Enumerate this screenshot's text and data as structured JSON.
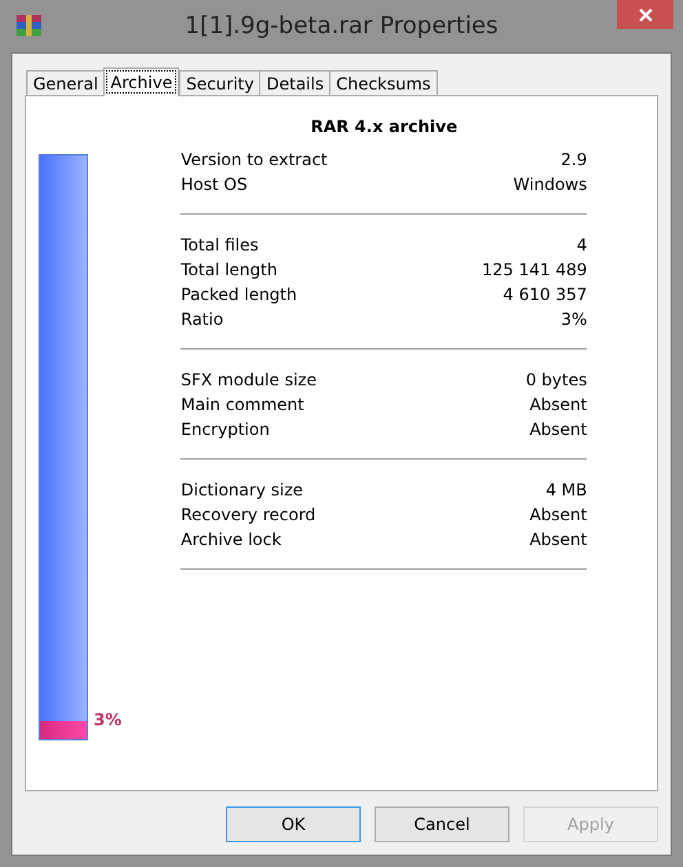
{
  "window": {
    "title": "1[1].9g-beta.rar Properties"
  },
  "tabs": [
    {
      "label": "General",
      "selected": false
    },
    {
      "label": "Archive",
      "selected": true
    },
    {
      "label": "Security",
      "selected": false
    },
    {
      "label": "Details",
      "selected": false
    },
    {
      "label": "Checksums",
      "selected": false
    }
  ],
  "ratio_bar": {
    "level": 0.03,
    "reading": "3%"
  },
  "heading": "RAR 4.x archive",
  "groups": [
    [
      {
        "label": "Version to extract",
        "value": "2.9"
      },
      {
        "label": "Host OS",
        "value": "Windows"
      }
    ],
    [
      {
        "label": "Total files",
        "value": "4"
      },
      {
        "label": "Total length",
        "value": "125 141 489"
      },
      {
        "label": "Packed length",
        "value": "4 610 357"
      },
      {
        "label": "Ratio",
        "value": "3%"
      }
    ],
    [
      {
        "label": "SFX module size",
        "value": "0 bytes"
      },
      {
        "label": "Main comment",
        "value": "Absent"
      },
      {
        "label": "Encryption",
        "value": "Absent"
      }
    ],
    [
      {
        "label": "Dictionary size",
        "value": "4 MB"
      },
      {
        "label": "Recovery record",
        "value": "Absent"
      },
      {
        "label": "Archive lock",
        "value": "Absent"
      }
    ]
  ],
  "buttons": [
    {
      "label": "OK",
      "focused": true,
      "disabled": false
    },
    {
      "label": "Cancel",
      "focused": false,
      "disabled": false
    },
    {
      "label": "Apply",
      "focused": false,
      "disabled": true
    }
  ]
}
